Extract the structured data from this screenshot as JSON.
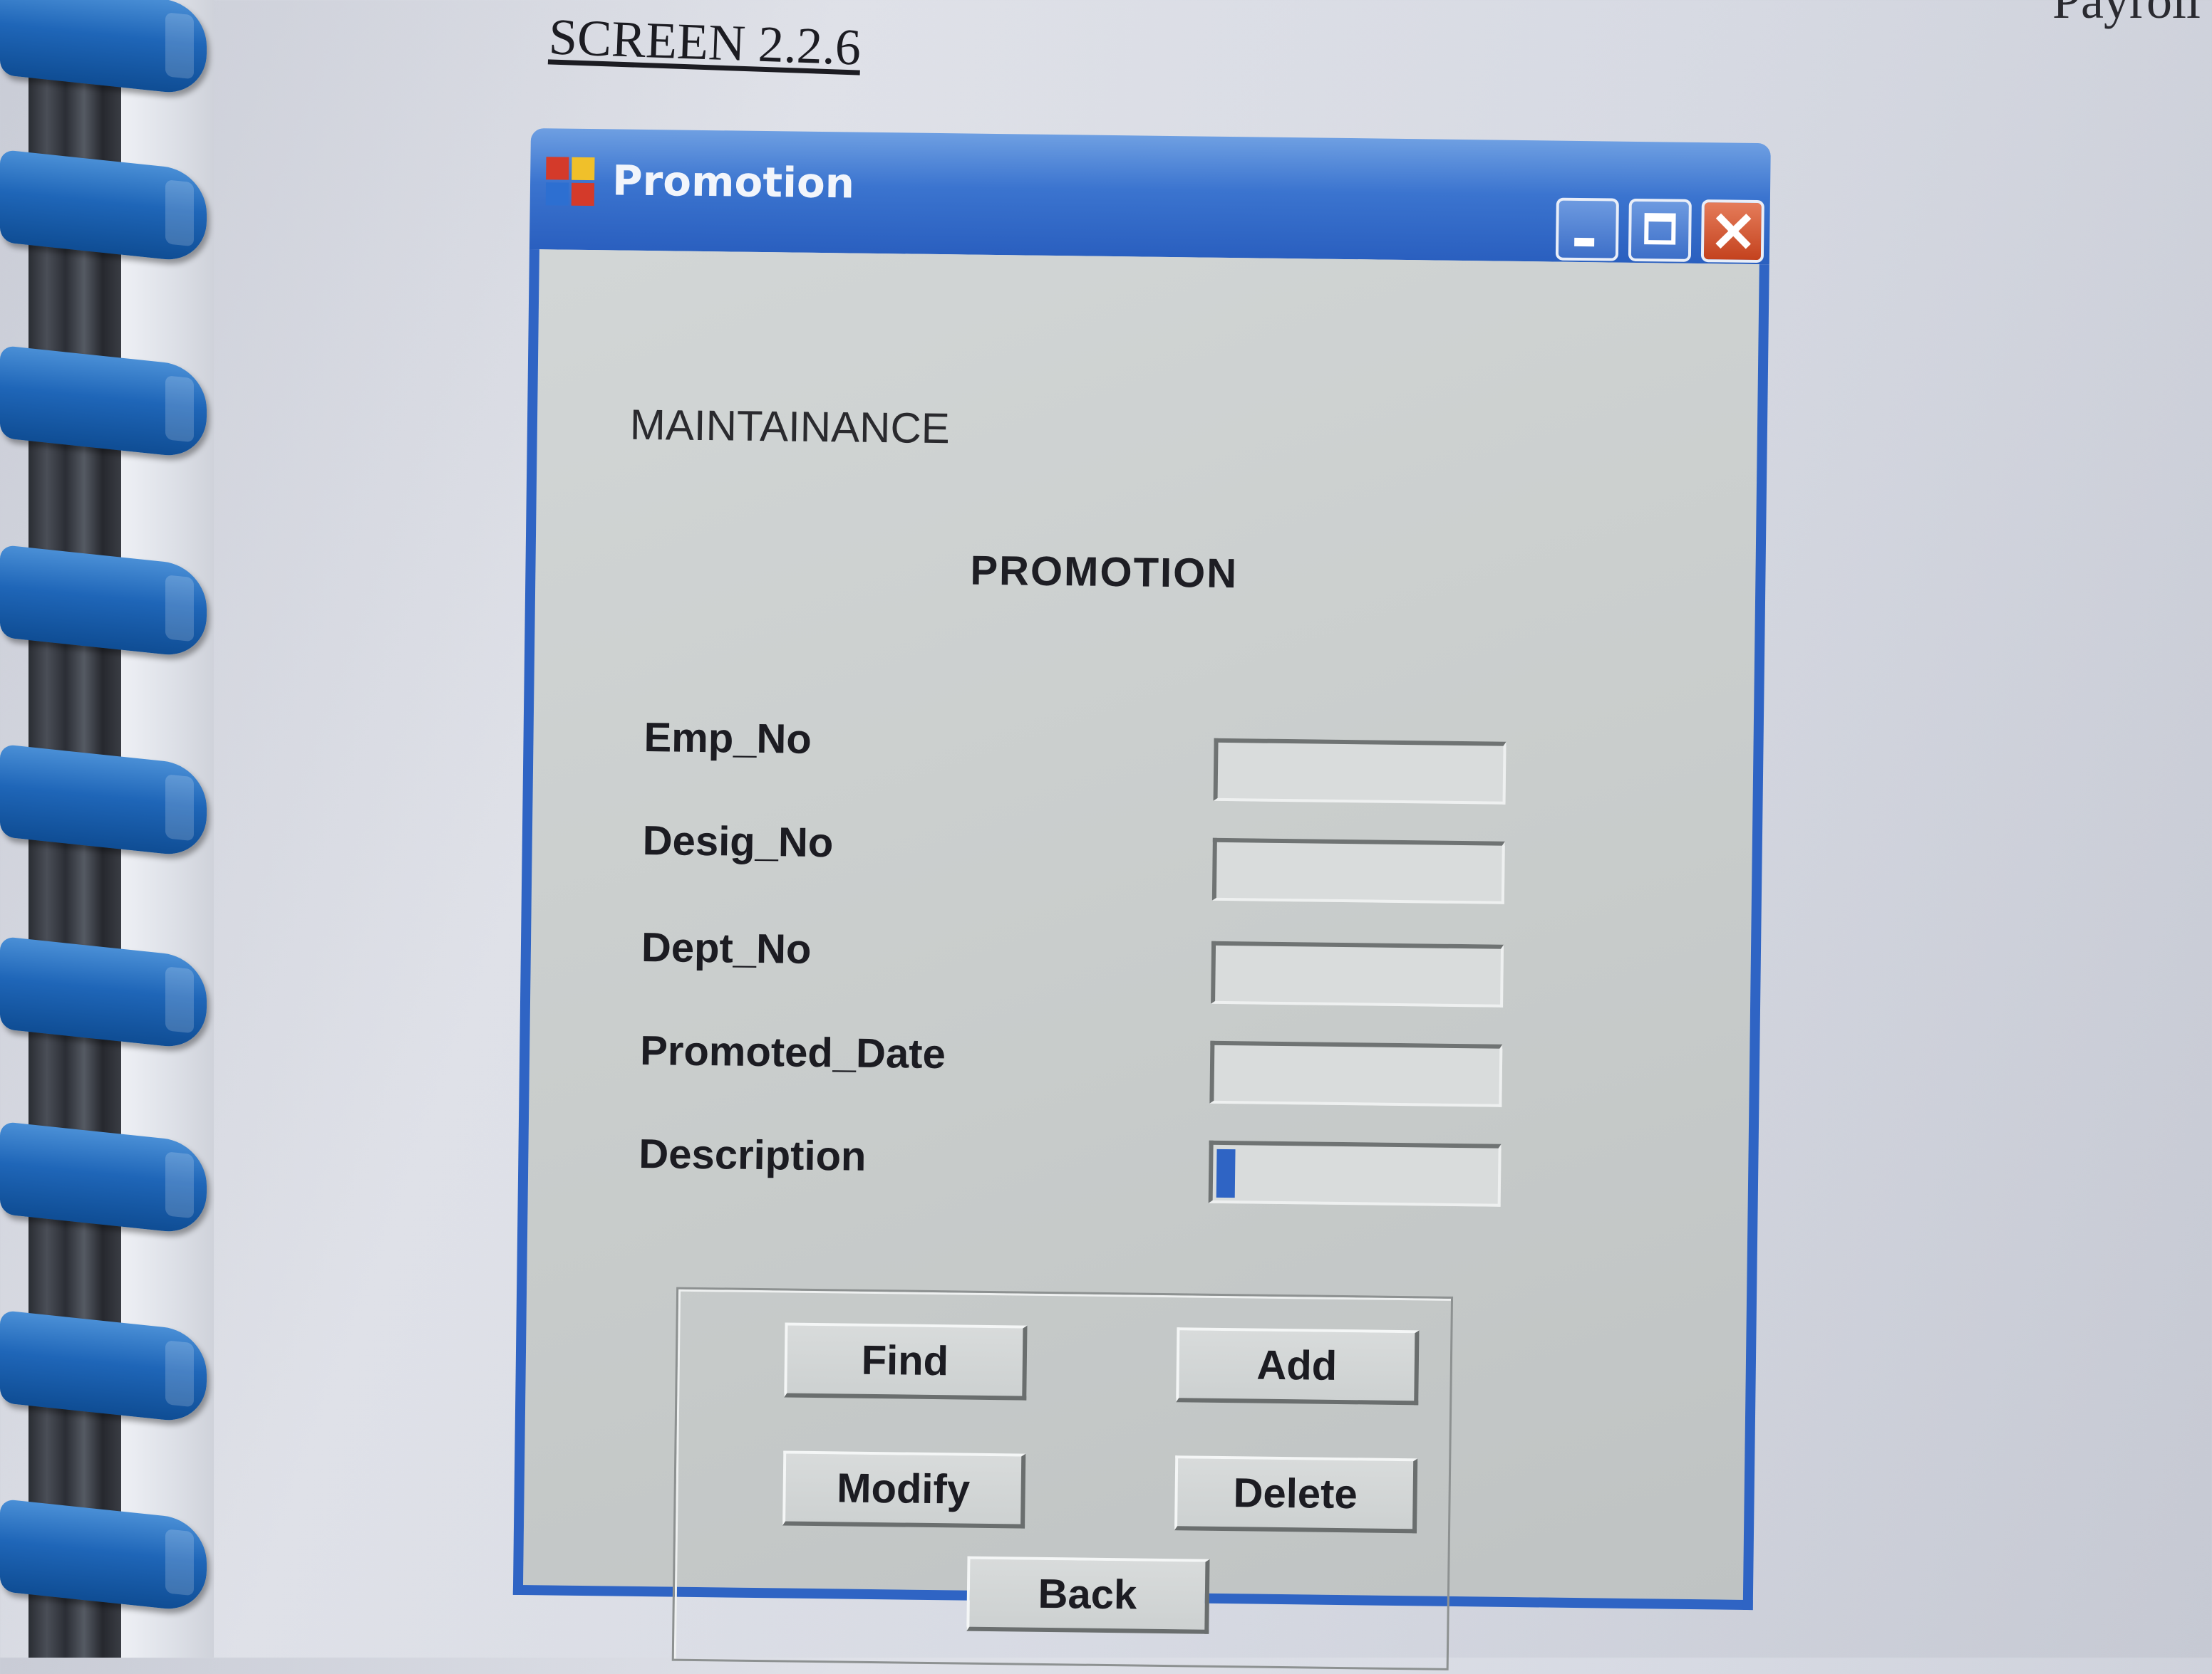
{
  "page": {
    "heading": "SCREEN 2.2.6",
    "corner_text": "Payroll"
  },
  "window": {
    "title": "Promotion",
    "icon": "app-grid-icon",
    "controls": {
      "minimize": "minimize-icon",
      "maximize": "maximize-icon",
      "close": "close-icon"
    },
    "colors": {
      "titlebar": "#2f64c4",
      "client": "#c9cdcc",
      "close": "#c4421e"
    }
  },
  "form": {
    "menu_label": "MAINTAINANCE",
    "title": "PROMOTION",
    "fields": [
      {
        "label": "Emp_No",
        "value": ""
      },
      {
        "label": "Desig_No",
        "value": ""
      },
      {
        "label": "Dept_No",
        "value": ""
      },
      {
        "label": "Promoted_Date",
        "value": ""
      },
      {
        "label": "Description",
        "value": ""
      }
    ]
  },
  "buttons": {
    "find": "Find",
    "add": "Add",
    "modify": "Modify",
    "delete": "Delete",
    "back": "Back"
  }
}
